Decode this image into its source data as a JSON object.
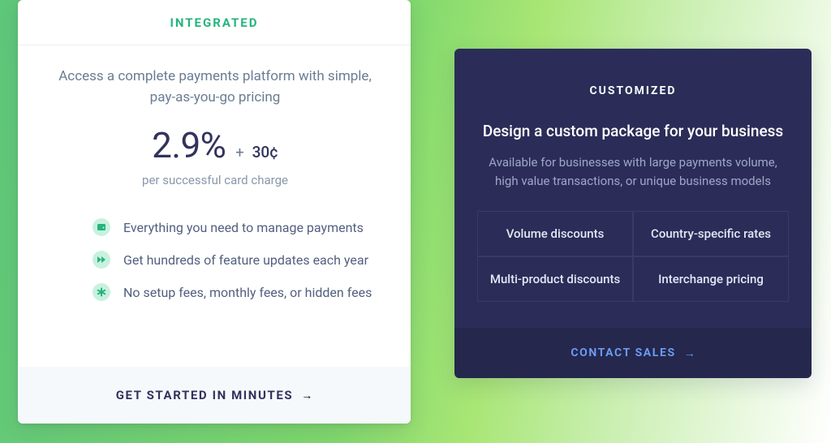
{
  "integrated": {
    "title": "INTEGRATED",
    "description": "Access a complete payments platform with simple, pay-as-you-go pricing",
    "percent": "2.9%",
    "plus": "+",
    "cents": "30¢",
    "per": "per successful card charge",
    "features": [
      "Everything you need to manage payments",
      "Get hundreds of feature updates each year",
      "No setup fees, monthly fees, or hidden fees"
    ],
    "cta": "GET STARTED IN MINUTES"
  },
  "customized": {
    "title": "CUSTOMIZED",
    "heading": "Design a custom package for your business",
    "description": "Available for businesses with large payments volume, high value transactions, or unique business models",
    "grid": [
      "Volume discounts",
      "Country-specific rates",
      "Multi-product discounts",
      "Interchange pricing"
    ],
    "cta": "CONTACT SALES"
  }
}
